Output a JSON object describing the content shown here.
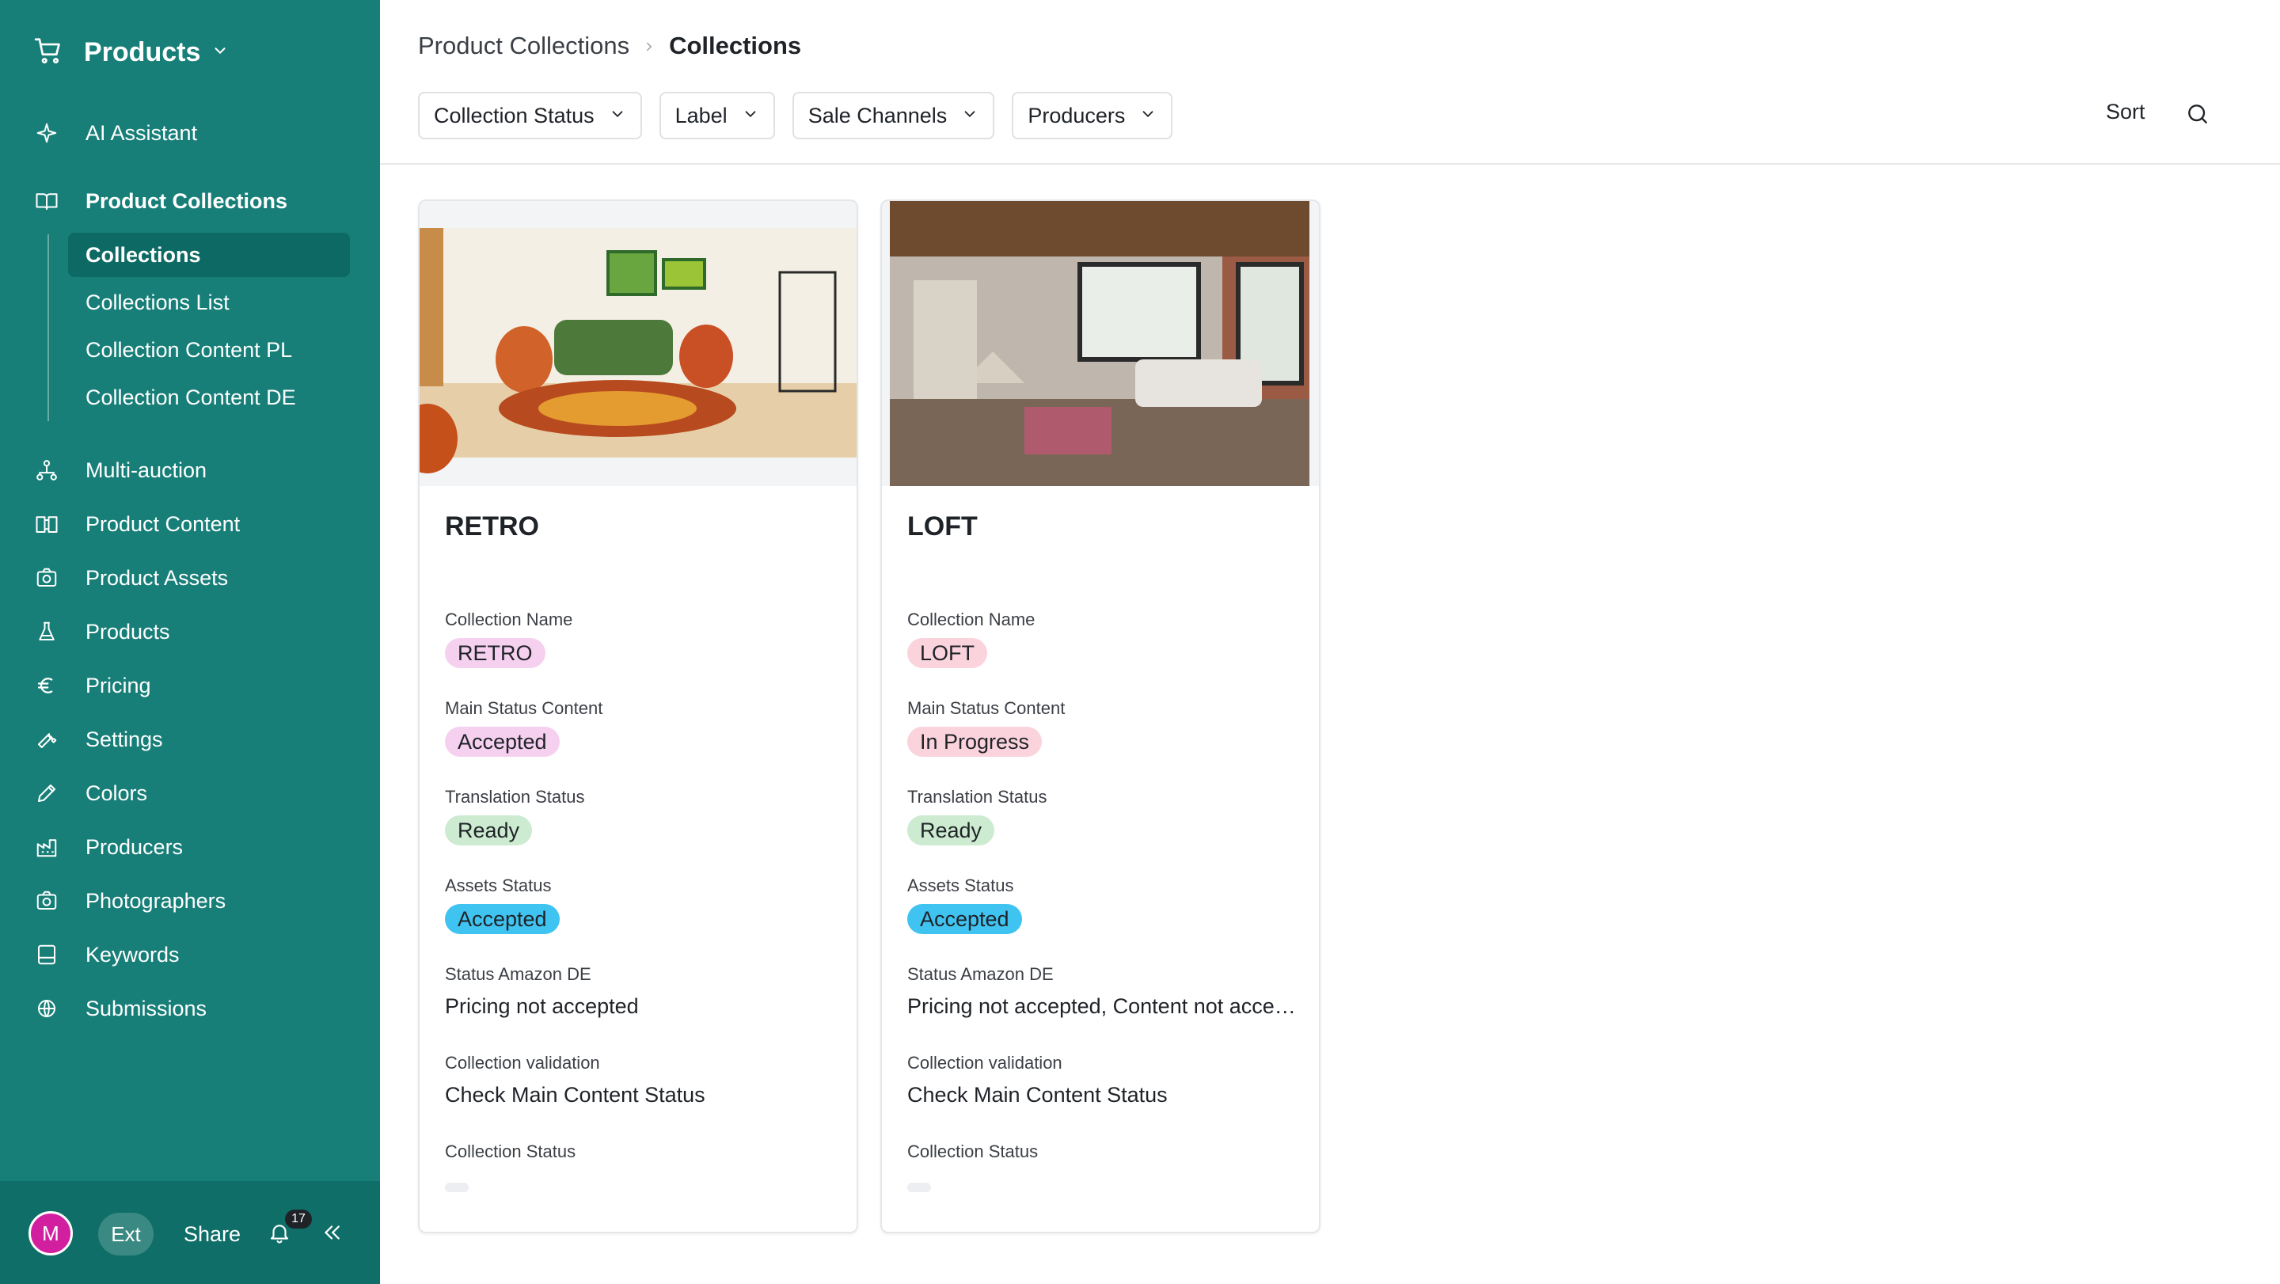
{
  "sidebar": {
    "title": "Products",
    "nav_top": [
      {
        "label": "AI Assistant",
        "icon": "sparkle-icon"
      }
    ],
    "section": {
      "label": "Product Collections",
      "icon": "book-icon"
    },
    "sub_items": [
      {
        "label": "Collections",
        "active": true
      },
      {
        "label": "Collections List",
        "active": false
      },
      {
        "label": "Collection Content PL",
        "active": false
      },
      {
        "label": "Collection Content DE",
        "active": false
      }
    ],
    "nav_items": [
      {
        "label": "Multi-auction",
        "icon": "hierarchy-icon"
      },
      {
        "label": "Product Content",
        "icon": "book-open-icon"
      },
      {
        "label": "Product Assets",
        "icon": "camera-icon"
      },
      {
        "label": "Products",
        "icon": "flask-icon"
      },
      {
        "label": "Pricing",
        "icon": "euro-icon"
      },
      {
        "label": "Settings",
        "icon": "wrench-icon"
      },
      {
        "label": "Colors",
        "icon": "pencil-icon"
      },
      {
        "label": "Producers",
        "icon": "factory-icon"
      },
      {
        "label": "Photographers",
        "icon": "camera-icon"
      },
      {
        "label": "Keywords",
        "icon": "inbox-icon"
      },
      {
        "label": "Submissions",
        "icon": "globe-icon"
      }
    ],
    "footer": {
      "avatar_initial": "M",
      "ext_label": "Ext",
      "share_label": "Share",
      "notification_count": "17"
    }
  },
  "header": {
    "breadcrumb": [
      "Product Collections",
      "Collections"
    ],
    "filters": [
      "Collection Status",
      "Label",
      "Sale Channels",
      "Producers"
    ],
    "sort_label": "Sort"
  },
  "cards": [
    {
      "title": "RETRO",
      "fields": {
        "collection_name": {
          "label": "Collection Name",
          "value": "RETRO",
          "color": "#f6d0ef"
        },
        "main_status": {
          "label": "Main Status Content",
          "value": "Accepted",
          "color": "#f6d0ef"
        },
        "translation_status": {
          "label": "Translation Status",
          "value": "Ready",
          "color": "#cdebd0"
        },
        "assets_status": {
          "label": "Assets Status",
          "value": "Accepted",
          "color": "#3fc3f0"
        },
        "amazon_status": {
          "label": "Status Amazon DE",
          "value": "Pricing not accepted"
        },
        "validation": {
          "label": "Collection validation",
          "value": "Check Main Content Status"
        },
        "collection_status": {
          "label": "Collection Status"
        }
      }
    },
    {
      "title": "LOFT",
      "fields": {
        "collection_name": {
          "label": "Collection Name",
          "value": "LOFT",
          "color": "#fbd3dc"
        },
        "main_status": {
          "label": "Main Status Content",
          "value": "In Progress",
          "color": "#fbd3dc"
        },
        "translation_status": {
          "label": "Translation Status",
          "value": "Ready",
          "color": "#cdebd0"
        },
        "assets_status": {
          "label": "Assets Status",
          "value": "Accepted",
          "color": "#3fc3f0"
        },
        "amazon_status": {
          "label": "Status Amazon DE",
          "value": "Pricing not accepted, Content not accepted"
        },
        "validation": {
          "label": "Collection validation",
          "value": "Check Main Content Status"
        },
        "collection_status": {
          "label": "Collection Status"
        }
      }
    }
  ]
}
